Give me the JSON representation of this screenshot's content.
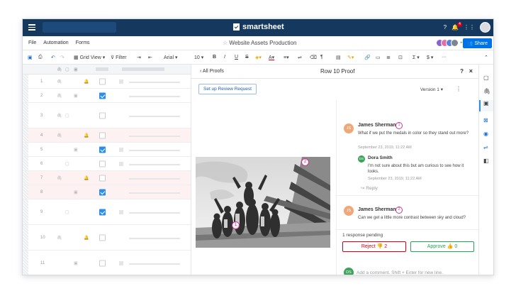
{
  "app": {
    "logo_text": "smartsheet",
    "notification_count": "4"
  },
  "menu": {
    "items": [
      "File",
      "Automation",
      "Forms"
    ],
    "sheet_title": "Website Assets Production",
    "collaborators_more": "+6",
    "share_label": "Share"
  },
  "toolbar": {
    "grid_view": "Grid View",
    "filter": "Filter",
    "font": "Arial",
    "font_size": "10",
    "bold": "B",
    "italic": "I",
    "underline": "U",
    "strike": "S",
    "sum": "Σ",
    "currency": "$",
    "more": "···"
  },
  "grid": {
    "rows": [
      {
        "num": "1",
        "checked": false,
        "pink": false
      },
      {
        "num": "2",
        "checked": true,
        "pink": false
      },
      {
        "num": "3",
        "checked": false,
        "pink": false
      },
      {
        "num": "4",
        "checked": false,
        "pink": true
      },
      {
        "num": "5",
        "checked": true,
        "pink": false
      },
      {
        "num": "6",
        "checked": false,
        "pink": false
      },
      {
        "num": "7",
        "checked": false,
        "pink": true
      },
      {
        "num": "8",
        "checked": true,
        "pink": true
      },
      {
        "num": "9",
        "checked": true,
        "pink": false
      },
      {
        "num": "10",
        "checked": false,
        "pink": false
      },
      {
        "num": "11",
        "checked": false,
        "pink": false
      }
    ]
  },
  "proof": {
    "back_label": "All Proofs",
    "title": "Row 10 Proof",
    "help": "?",
    "close": "×",
    "setup_button": "Set up Review Request",
    "version": "Version 1",
    "pins": [
      "1",
      "2"
    ]
  },
  "comments": {
    "c1": {
      "initials": "JS",
      "name": "James Sherman",
      "pin": "1",
      "text": "What if we put the medals in color so they stand out more?",
      "date": "September 23, 2019, 11:22 AM"
    },
    "c1_reply": {
      "initials": "DS",
      "name": "Dora Smith",
      "text": "I'm not sure about this but am curious to see how it looks.",
      "date": "September 23, 2019, 11:22 AM"
    },
    "reply_label": "Reply",
    "c2": {
      "initials": "JS",
      "name": "James Sherman",
      "pin": "2",
      "text": "Can we get a little more contrast between sky and cloud?"
    },
    "pending": "1 response pending",
    "reject_label": "Reject",
    "reject_count": "2",
    "approve_label": "Approve",
    "approve_count": "0",
    "composer_initials": "DS",
    "add_placeholder": "Add a comment. Shift + Enter for new line."
  },
  "colors": {
    "topbar": "#15385e",
    "accent": "#2c8ee6",
    "reject": "#d0021b",
    "approve": "#23a45b",
    "pin": "#c23c8c",
    "avatar_orange": "#f0a77a",
    "avatar_green": "#3da35a"
  }
}
